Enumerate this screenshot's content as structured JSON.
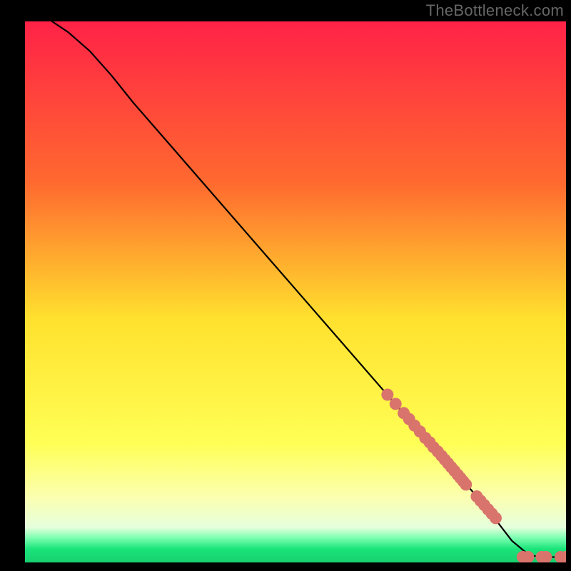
{
  "watermark": "TheBottleneck.com",
  "colors": {
    "gradient_top": "#ff2247",
    "gradient_upper_mid": "#ff8a2b",
    "gradient_mid": "#ffe12e",
    "gradient_lower_mid": "#f6ff6b",
    "gradient_near_bottom_pale": "#f0ffc8",
    "gradient_green_light": "#7affb0",
    "gradient_green": "#1ae47a",
    "curve": "#000000",
    "markers": "#d9746c",
    "frame": "#000000"
  },
  "chart_data": {
    "type": "line",
    "title": "",
    "xlabel": "",
    "ylabel": "",
    "xlim": [
      0,
      100
    ],
    "ylim": [
      0,
      100
    ],
    "series": [
      {
        "name": "curve",
        "x": [
          5,
          8,
          12,
          16,
          20,
          30,
          40,
          50,
          60,
          70,
          78,
          85,
          90,
          93,
          95,
          97,
          100
        ],
        "y": [
          100,
          98,
          94.5,
          90,
          85,
          73.5,
          62,
          50.5,
          39,
          27.5,
          18.5,
          10.5,
          4,
          1.5,
          1,
          1,
          1
        ],
        "markers": false
      },
      {
        "name": "markers-upper",
        "x": [
          67,
          68.5,
          70,
          71,
          72,
          73,
          74,
          74.8,
          75.5,
          76.3,
          77,
          77.6,
          78.2,
          78.8,
          79.4,
          80,
          80.5,
          81,
          81.5,
          83.5,
          84.2,
          84.9,
          85.6,
          86.3,
          87
        ],
        "y": [
          31,
          29.3,
          27.6,
          26.5,
          25.3,
          24.2,
          23,
          22.2,
          21.3,
          20.5,
          19.7,
          19,
          18.3,
          17.6,
          16.9,
          16.2,
          15.6,
          15,
          14.4,
          12.2,
          11.4,
          10.6,
          9.8,
          9,
          8.2
        ],
        "markers": true
      },
      {
        "name": "markers-tail",
        "x": [
          92,
          93,
          95.5,
          96.3,
          99,
          100
        ],
        "y": [
          1,
          1,
          1,
          1,
          1,
          1
        ],
        "markers": true
      }
    ]
  }
}
